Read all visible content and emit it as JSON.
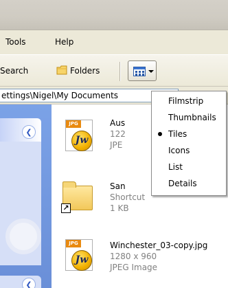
{
  "menubar": {
    "items": [
      "Tools",
      "Help"
    ]
  },
  "toolbar": {
    "search_label": "Search",
    "folders_label": "Folders",
    "views_icon": "views-icon"
  },
  "address": {
    "value": "ettings\\Nigel\\My Documents"
  },
  "files": [
    {
      "name": "Aus",
      "line2": "122",
      "line3": "JPE",
      "icon": "jpg-file-icon",
      "tag": "JPG",
      "badge": "Jw"
    },
    {
      "name": "San",
      "line2": "Shortcut",
      "line3": "1 KB",
      "icon": "folder-shortcut-icon"
    },
    {
      "name": "Winchester_03-copy.jpg",
      "line2": "1280 x 960",
      "line3": "JPEG Image",
      "icon": "jpg-file-icon",
      "tag": "JPG",
      "badge": "Jw"
    }
  ],
  "views_menu": {
    "items": [
      "Filmstrip",
      "Thumbnails",
      "Tiles",
      "Icons",
      "List",
      "Details"
    ],
    "selected": "Tiles"
  },
  "colors": {
    "task_pane": "#7ba2e7",
    "menu_bg": "#ece9d8",
    "jpg_tag": "#e98a10"
  }
}
